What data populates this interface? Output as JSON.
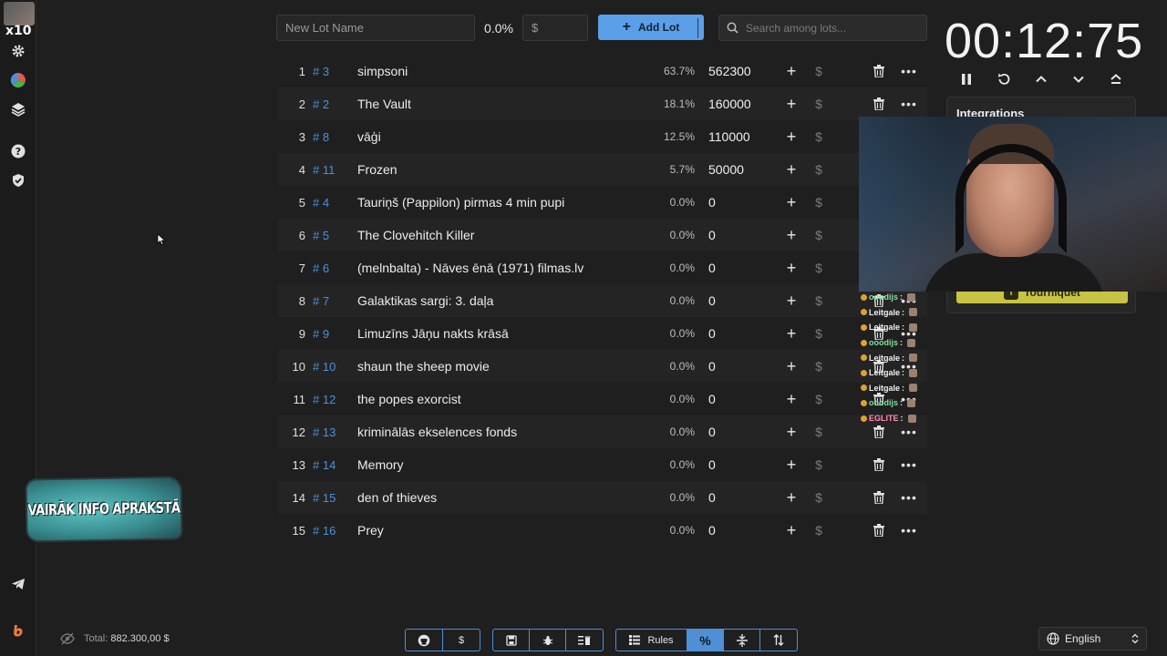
{
  "sidebar": {
    "badge": "x10",
    "icons": [
      "settings-icon",
      "pie-chart-icon",
      "layers-icon",
      "help-icon",
      "shield-check-icon",
      "telegram-icon",
      "brand-logo-icon"
    ]
  },
  "toolbar": {
    "name_placeholder": "New Lot Name",
    "percent_value": "0.0%",
    "amount_placeholder": "$",
    "add_label": "Add Lot",
    "search_placeholder": "Search among lots..."
  },
  "lots": [
    {
      "index": "1",
      "id": "# 3",
      "name": "simpsoni",
      "percent": "63.7%",
      "amount": "562300"
    },
    {
      "index": "2",
      "id": "# 2",
      "name": "The Vault",
      "percent": "18.1%",
      "amount": "160000"
    },
    {
      "index": "3",
      "id": "# 8",
      "name": "vāģi",
      "percent": "12.5%",
      "amount": "110000"
    },
    {
      "index": "4",
      "id": "# 11",
      "name": "Frozen",
      "percent": "5.7%",
      "amount": "50000"
    },
    {
      "index": "5",
      "id": "# 4",
      "name": "Tauriņš (Pappilon) pirmas 4 min pupi",
      "percent": "0.0%",
      "amount": "0"
    },
    {
      "index": "6",
      "id": "# 5",
      "name": "The Clovehitch Killer",
      "percent": "0.0%",
      "amount": "0"
    },
    {
      "index": "7",
      "id": "# 6",
      "name": "(melnbalta) - Nāves ēnā (1971) filmas.lv",
      "percent": "0.0%",
      "amount": "0"
    },
    {
      "index": "8",
      "id": "# 7",
      "name": "Galaktikas sargi: 3. daļa",
      "percent": "0.0%",
      "amount": "0"
    },
    {
      "index": "9",
      "id": "# 9",
      "name": "Limuzīns Jāņu nakts krāsā",
      "percent": "0.0%",
      "amount": "0"
    },
    {
      "index": "10",
      "id": "# 10",
      "name": "shaun the sheep movie",
      "percent": "0.0%",
      "amount": "0"
    },
    {
      "index": "11",
      "id": "# 12",
      "name": "the popes exorcist",
      "percent": "0.0%",
      "amount": "0"
    },
    {
      "index": "12",
      "id": "# 13",
      "name": "kriminālās ekselences fonds",
      "percent": "0.0%",
      "amount": "0"
    },
    {
      "index": "13",
      "id": "# 14",
      "name": "Memory",
      "percent": "0.0%",
      "amount": "0"
    },
    {
      "index": "14",
      "id": "# 15",
      "name": "den of thieves",
      "percent": "0.0%",
      "amount": "0"
    },
    {
      "index": "15",
      "id": "# 16",
      "name": "Prey",
      "percent": "0.0%",
      "amount": "0"
    }
  ],
  "timer": {
    "display": "00:12:75"
  },
  "integrations": {
    "title": "Integrations",
    "tourniquet_label": "Tourniquet"
  },
  "chat": [
    {
      "user": "ooodijs",
      "sep": ":",
      "style": "u1"
    },
    {
      "user": "Leitgale",
      "sep": ":",
      "style": "u2"
    },
    {
      "user": "Leitgale",
      "sep": ":",
      "style": "u2"
    },
    {
      "user": "ooodijs",
      "sep": ":",
      "style": "u1"
    },
    {
      "user": "Leitgale",
      "sep": ":",
      "style": "u2"
    },
    {
      "user": "Leitgale",
      "sep": ":",
      "style": "u2"
    },
    {
      "user": "Leitgale",
      "sep": ":",
      "style": "u2"
    },
    {
      "user": "ooodijs",
      "sep": ":",
      "style": "u1"
    },
    {
      "user": "EGLITE",
      "sep": ":",
      "style": "u3"
    }
  ],
  "promo": {
    "text": "VAIRĀK INFO APRAKSTĀ"
  },
  "footer": {
    "total_label": "Total:",
    "total_value": "882.300,00 $",
    "rules_label": "Rules",
    "dollar_label": "$",
    "percent_label": "%",
    "language": "English"
  },
  "colors": {
    "accent": "#5b9fe8",
    "id_blue": "#4f8fd6",
    "background": "#1f1f1f",
    "tourniquet": "#c7c444"
  }
}
